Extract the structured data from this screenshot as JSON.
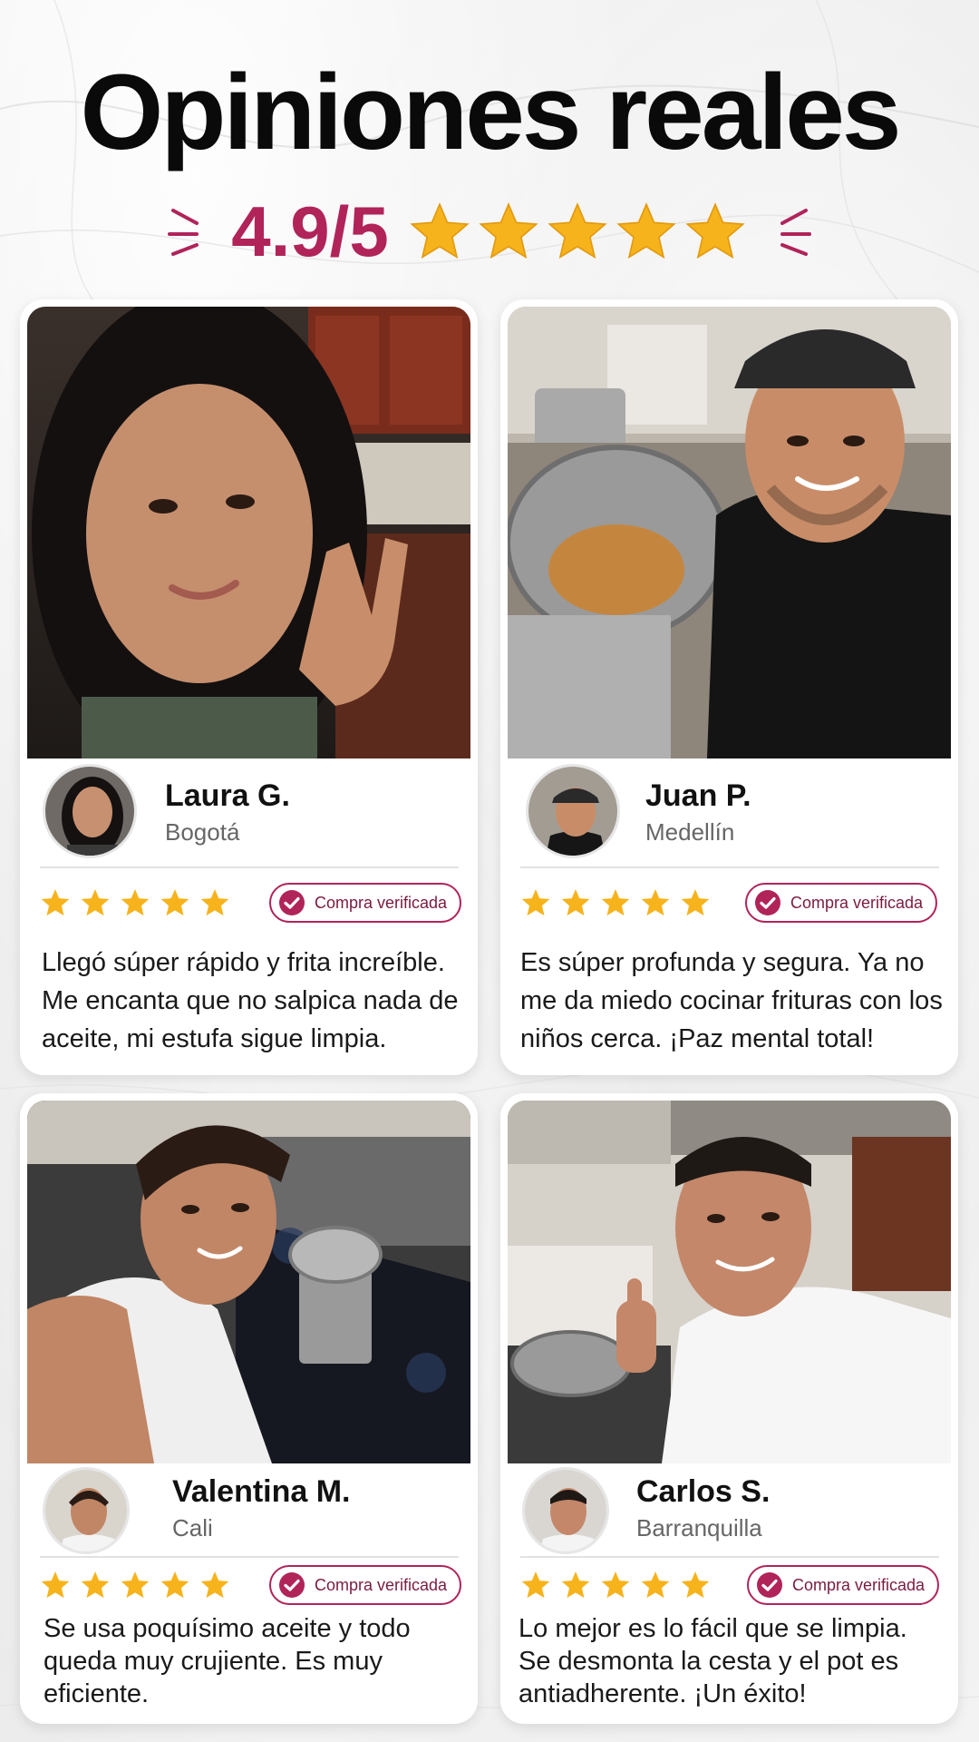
{
  "header": {
    "title": "Opiniones reales",
    "rating": "4.9/5",
    "star_count": 5
  },
  "colors": {
    "accent": "#b0245a",
    "star": "#f7b31b",
    "background": "#f1f1f1"
  },
  "badge_label": "Compra verificada",
  "reviews": [
    {
      "name": "Laura G.",
      "city": "Bogotá",
      "stars": 5,
      "text": "Llegó súper rápido y frita increíble. Me encanta que no salpica nada de aceite, mi estufa sigue limpia."
    },
    {
      "name": "Juan P.",
      "city": "Medellín",
      "stars": 5,
      "text": "Es súper profunda y segura. Ya no me da miedo cocinar frituras con los niños cerca. ¡Paz mental total!"
    },
    {
      "name": "Valentina M.",
      "city": "Cali",
      "stars": 5,
      "text": "Se usa poquísimo aceite y todo queda muy crujiente. Es muy eficiente."
    },
    {
      "name": "Carlos S.",
      "city": "Barranquilla",
      "stars": 5,
      "text": "Lo mejor es lo fácil que se limpia. Se desmonta la cesta y el pot es antiadherente. ¡Un éxito!"
    }
  ]
}
